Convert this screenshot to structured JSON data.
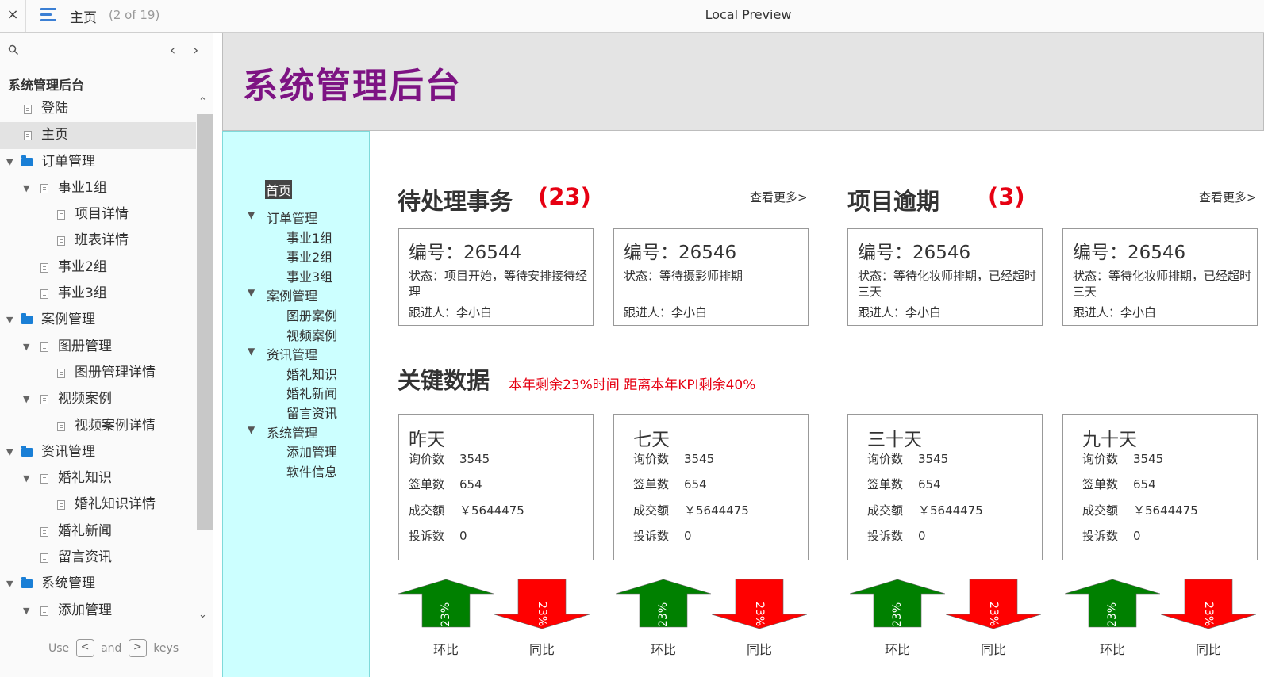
{
  "app": {
    "close_glyph": "×",
    "page_name": "主页",
    "page_count": "(2 of 19)",
    "preview_title": "Local Preview"
  },
  "sitemap": {
    "root": "系统管理后台",
    "items": [
      {
        "label": "登陆",
        "type": "page",
        "level": 0
      },
      {
        "label": "主页",
        "type": "page",
        "level": 0,
        "active": true
      },
      {
        "label": "订单管理",
        "type": "folder",
        "level": 0
      },
      {
        "label": "事业1组",
        "type": "page",
        "level": 1,
        "expandable": true
      },
      {
        "label": "项目详情",
        "type": "page",
        "level": 2
      },
      {
        "label": "班表详情",
        "type": "page",
        "level": 2
      },
      {
        "label": "事业2组",
        "type": "page",
        "level": 1
      },
      {
        "label": "事业3组",
        "type": "page",
        "level": 1
      },
      {
        "label": "案例管理",
        "type": "folder",
        "level": 0
      },
      {
        "label": "图册管理",
        "type": "page",
        "level": 1,
        "expandable": true
      },
      {
        "label": "图册管理详情",
        "type": "page",
        "level": 2
      },
      {
        "label": "视频案例",
        "type": "page",
        "level": 1,
        "expandable": true
      },
      {
        "label": "视频案例详情",
        "type": "page",
        "level": 2
      },
      {
        "label": "资讯管理",
        "type": "folder",
        "level": 0
      },
      {
        "label": "婚礼知识",
        "type": "page",
        "level": 1,
        "expandable": true
      },
      {
        "label": "婚礼知识详情",
        "type": "page",
        "level": 2
      },
      {
        "label": "婚礼新闻",
        "type": "page",
        "level": 1
      },
      {
        "label": "留言资讯",
        "type": "page",
        "level": 1
      },
      {
        "label": "系统管理",
        "type": "folder",
        "level": 0
      },
      {
        "label": "添加管理",
        "type": "page",
        "level": 1,
        "expandable": true
      }
    ],
    "hint": {
      "use": "Use",
      "key_prev": "<",
      "and": "and",
      "key_next": ">",
      "keys": "keys"
    }
  },
  "proto": {
    "title": "系统管理后台",
    "nav": {
      "home": "首页",
      "groups": [
        {
          "label": "订单管理",
          "children": [
            "事业1组",
            "事业2组",
            "事业3组"
          ]
        },
        {
          "label": "案例管理",
          "children": [
            "图册案例",
            "视频案例"
          ]
        },
        {
          "label": "资讯管理",
          "children": [
            "婚礼知识",
            "婚礼新闻",
            "留言资讯"
          ]
        },
        {
          "label": "系统管理",
          "children": [
            "添加管理",
            "软件信息"
          ]
        }
      ]
    },
    "pending": {
      "title": "待处理事务",
      "count": "(23)",
      "more": "查看更多>",
      "cards": [
        {
          "no": "编号：26544",
          "status": "状态：项目开始，等待安排接待经理",
          "follower": "跟进人：李小白"
        },
        {
          "no": "编号：26546",
          "status": "状态：等待摄影师排期",
          "follower": "跟进人：李小白"
        }
      ]
    },
    "overdue": {
      "title": "项目逾期",
      "count": "(3)",
      "more": "查看更多>",
      "cards": [
        {
          "no": "编号：26546",
          "status": "状态：等待化妆师排期，已经超时三天",
          "follower": "跟进人：李小白"
        },
        {
          "no": "编号：26546",
          "status": "状态：等待化妆师排期，已经超时三天",
          "follower": "跟进人：李小白"
        }
      ]
    },
    "key_data": {
      "title": "关键数据",
      "subtitle": "本年剩余23%时间  距离本年KPI剩余40%",
      "cards": [
        {
          "title": "昨天",
          "rows": [
            [
              "询价数",
              "3545"
            ],
            [
              "签单数",
              "654"
            ],
            [
              "成交额",
              "￥5644475"
            ],
            [
              "投诉数",
              "0"
            ]
          ]
        },
        {
          "title": "七天",
          "rows": [
            [
              "询价数",
              "3545"
            ],
            [
              "签单数",
              "654"
            ],
            [
              "成交额",
              "￥5644475"
            ],
            [
              "投诉数",
              "0"
            ]
          ]
        },
        {
          "title": "三十天",
          "rows": [
            [
              "询价数",
              "3545"
            ],
            [
              "签单数",
              "654"
            ],
            [
              "成交额",
              "￥5644475"
            ],
            [
              "投诉数",
              "0"
            ]
          ]
        },
        {
          "title": "九十天",
          "rows": [
            [
              "询价数",
              "3545"
            ],
            [
              "签单数",
              "654"
            ],
            [
              "成交额",
              "￥5644475"
            ],
            [
              "投诉数",
              "0"
            ]
          ]
        }
      ],
      "arrows": [
        {
          "up": {
            "value": "23%",
            "label": "环比"
          },
          "down": {
            "value": "23%",
            "label": "同比"
          }
        },
        {
          "up": {
            "value": "23%",
            "label": "环比"
          },
          "down": {
            "value": "23%",
            "label": "同比"
          }
        },
        {
          "up": {
            "value": "23%",
            "label": "环比"
          },
          "down": {
            "value": "23%",
            "label": "同比"
          }
        },
        {
          "up": {
            "value": "23%",
            "label": "环比"
          },
          "down": {
            "value": "23%",
            "label": "同比"
          }
        }
      ]
    }
  },
  "colors": {
    "title_purple": "#7d1383",
    "alert_red": "#e60012",
    "nav_cyan": "#ccffff",
    "arrow_green": "#008000",
    "arrow_red": "#ff0000",
    "folder_blue": "#1a7fd6"
  }
}
